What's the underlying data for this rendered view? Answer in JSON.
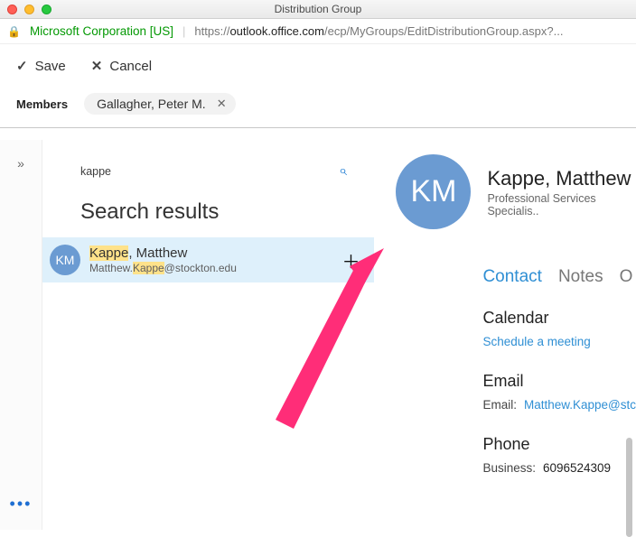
{
  "window": {
    "title": "Distribution Group"
  },
  "address": {
    "org": "Microsoft Corporation [US]",
    "prefix": "https://",
    "host": "outlook.office.com",
    "path": "/ecp/MyGroups/EditDistributionGroup.aspx?..."
  },
  "toolbar": {
    "save": "Save",
    "cancel": "Cancel"
  },
  "members": {
    "label": "Members",
    "chip": {
      "name": "Gallagher, Peter M."
    }
  },
  "search": {
    "query": "kappe",
    "heading": "Search results",
    "result": {
      "initials": "KM",
      "name_hl": "Kappe",
      "name_rest": ", Matthew",
      "email_pre": "Matthew.",
      "email_hl": "Kappe",
      "email_post": "@stockton.edu"
    }
  },
  "profile": {
    "initials": "KM",
    "name": "Kappe, Matthew",
    "role": "Professional Services Specialis..",
    "tabs": {
      "contact": "Contact",
      "notes": "Notes",
      "org": "O"
    },
    "calendar": {
      "title": "Calendar",
      "link": "Schedule a meeting"
    },
    "email": {
      "title": "Email",
      "label": "Email:",
      "value": "Matthew.Kappe@stc"
    },
    "phone": {
      "title": "Phone",
      "label": "Business:",
      "value": "6096524309"
    }
  },
  "dots": "•••"
}
